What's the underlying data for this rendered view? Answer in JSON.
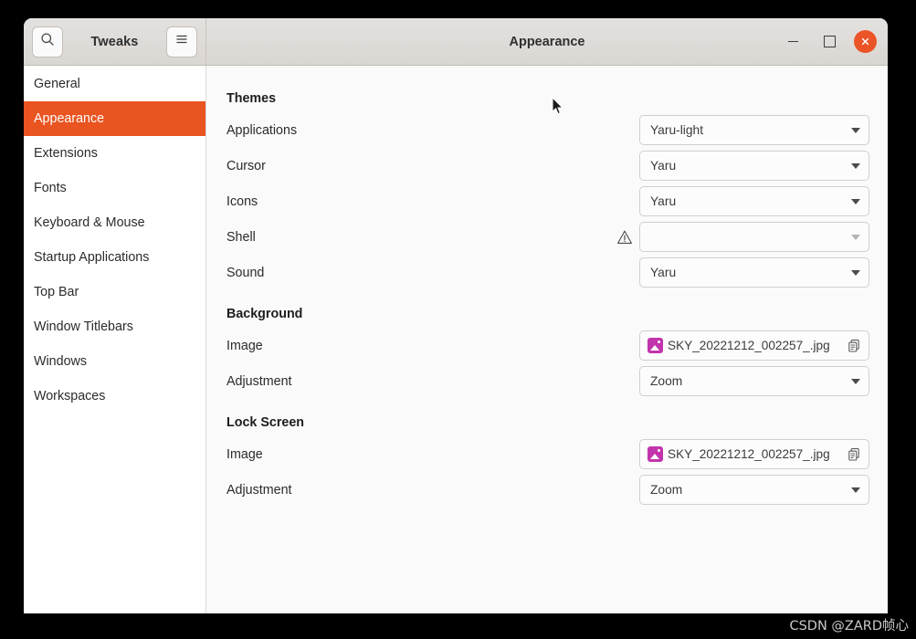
{
  "window": {
    "app_title": "Tweaks",
    "page_title": "Appearance",
    "search_icon": "search-icon",
    "menu_icon": "hamburger-menu-icon",
    "controls": {
      "minimize": "minimize",
      "maximize": "maximize",
      "close": "close"
    },
    "close_color": "#ea5426"
  },
  "sidebar": {
    "accent_color": "#e95420",
    "items": [
      {
        "label": "General",
        "selected": false
      },
      {
        "label": "Appearance",
        "selected": true
      },
      {
        "label": "Extensions",
        "selected": false
      },
      {
        "label": "Fonts",
        "selected": false
      },
      {
        "label": "Keyboard & Mouse",
        "selected": false
      },
      {
        "label": "Startup Applications",
        "selected": false
      },
      {
        "label": "Top Bar",
        "selected": false
      },
      {
        "label": "Window Titlebars",
        "selected": false
      },
      {
        "label": "Windows",
        "selected": false
      },
      {
        "label": "Workspaces",
        "selected": false
      }
    ]
  },
  "content": {
    "themes": {
      "heading": "Themes",
      "rows": [
        {
          "label": "Applications",
          "value": "Yaru-light",
          "type": "combo"
        },
        {
          "label": "Cursor",
          "value": "Yaru",
          "type": "combo"
        },
        {
          "label": "Icons",
          "value": "Yaru",
          "type": "combo"
        },
        {
          "label": "Shell",
          "value": "",
          "type": "combo",
          "warning": true,
          "warning_icon": "warning-triangle-icon"
        },
        {
          "label": "Sound",
          "value": "Yaru",
          "type": "combo"
        }
      ]
    },
    "background": {
      "heading": "Background",
      "image_label": "Image",
      "image_value": "SKY_20221212_002257_.jpg",
      "image_thumb_icon": "image-file-icon",
      "image_thumb_color": "#c234ac",
      "copy_icon": "copy-document-icon",
      "adjustment_label": "Adjustment",
      "adjustment_value": "Zoom"
    },
    "lock_screen": {
      "heading": "Lock Screen",
      "image_label": "Image",
      "image_value": "SKY_20221212_002257_.jpg",
      "image_thumb_icon": "image-file-icon",
      "image_thumb_color": "#c234ac",
      "copy_icon": "copy-document-icon",
      "adjustment_label": "Adjustment",
      "adjustment_value": "Zoom"
    }
  },
  "watermark": {
    "text": "CSDN @ZARD帧心"
  }
}
